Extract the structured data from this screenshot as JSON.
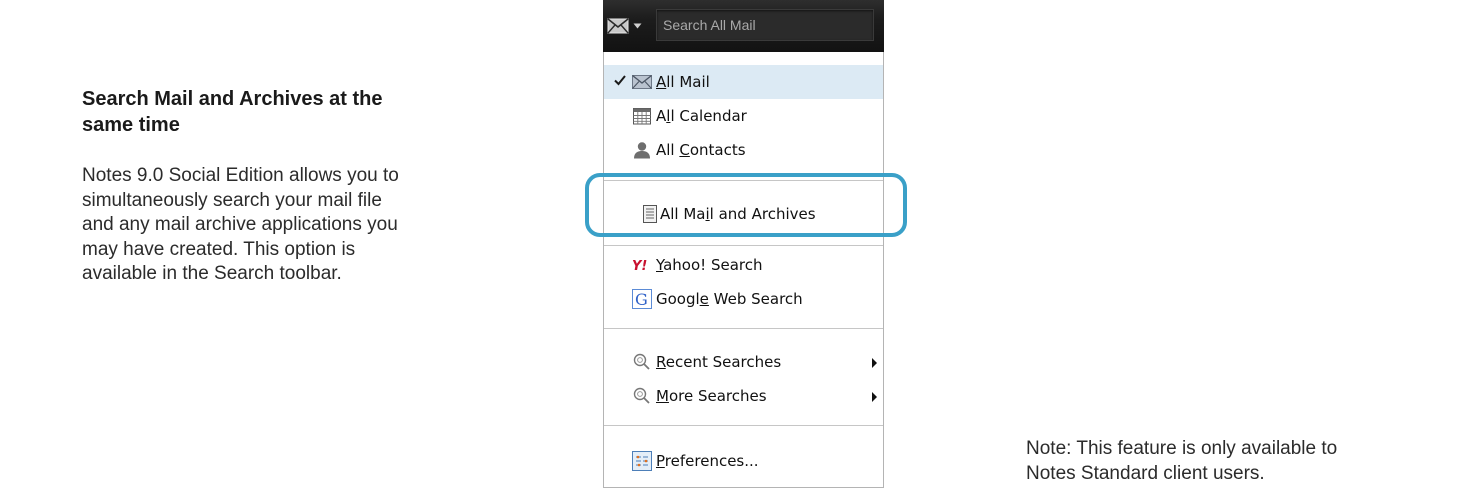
{
  "description": {
    "title": "Search Mail and Archives at the same time",
    "body": "Notes 9.0 Social Edition allows you to simultaneously search your mail file and any mail archive applications you may have created. This option is available in the Search toolbar."
  },
  "note": "Note: This feature is only available to Notes Standard client users.",
  "toolbar": {
    "search_placeholder": "Search All Mail",
    "mail_icon": "envelope-icon",
    "dropdown_icon": "caret-down-icon"
  },
  "menu": {
    "items": [
      {
        "pre": "",
        "mnemonic": "A",
        "post": "ll Mail",
        "icon": "envelope-icon",
        "checked": true,
        "submenu": false
      },
      {
        "pre": "A",
        "mnemonic": "l",
        "post": "l Calendar",
        "icon": "calendar-icon",
        "checked": false,
        "submenu": false
      },
      {
        "pre": "All ",
        "mnemonic": "C",
        "post": "ontacts",
        "icon": "person-icon",
        "checked": false,
        "submenu": false
      },
      {
        "pre": "All Ma",
        "mnemonic": "i",
        "post": "l and Archives",
        "icon": "document-icon",
        "checked": false,
        "submenu": false
      },
      {
        "pre": "",
        "mnemonic": "Y",
        "post": "ahoo! Search",
        "icon": "yahoo-icon",
        "checked": false,
        "submenu": false
      },
      {
        "pre": "Googl",
        "mnemonic": "e",
        "post": " Web Search",
        "icon": "google-icon",
        "checked": false,
        "submenu": false
      },
      {
        "pre": "",
        "mnemonic": "R",
        "post": "ecent Searches",
        "icon": "magnifier-icon",
        "checked": false,
        "submenu": true
      },
      {
        "pre": "",
        "mnemonic": "M",
        "post": "ore Searches",
        "icon": "magnifier-icon",
        "checked": false,
        "submenu": true
      },
      {
        "pre": "",
        "mnemonic": "P",
        "post": "references...",
        "icon": "preferences-icon",
        "checked": false,
        "submenu": false
      }
    ]
  },
  "colors": {
    "highlight_ring": "#3aa0c8",
    "checked_row_bg": "#dceaf4",
    "toolbar_bg": "#1d1d1d"
  }
}
